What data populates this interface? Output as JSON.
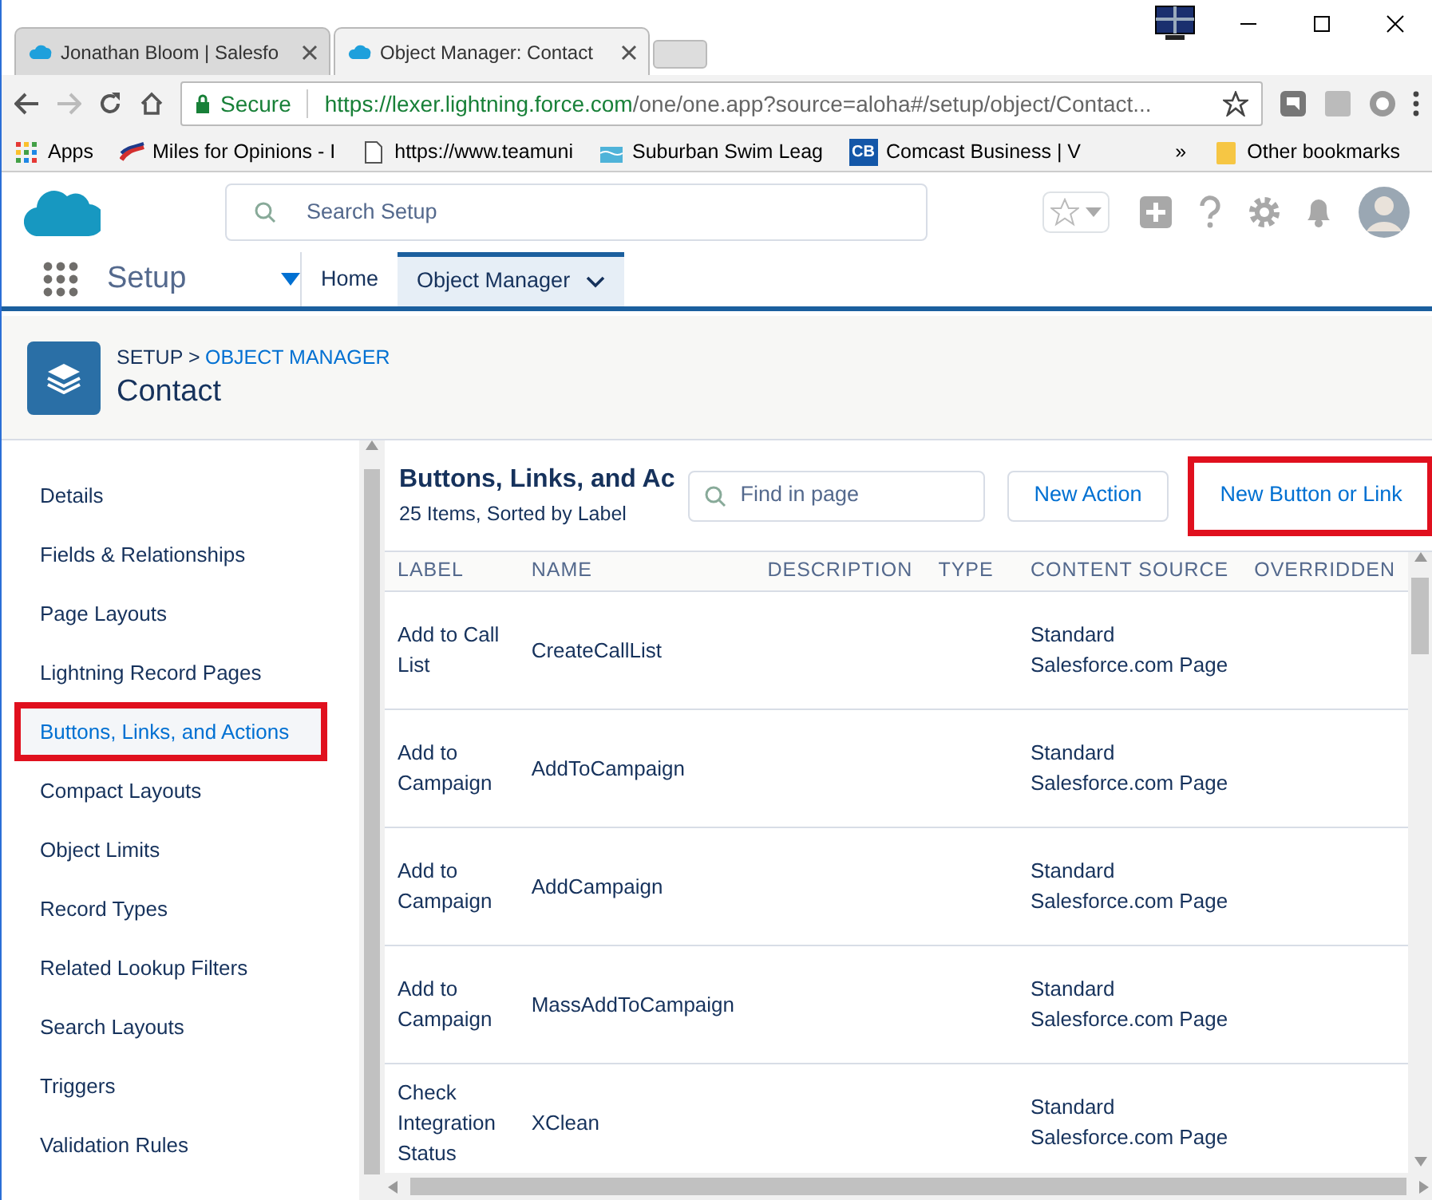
{
  "browser": {
    "tabs": [
      {
        "title": "Jonathan Bloom | Salesfo",
        "selected": false
      },
      {
        "title": "Object Manager: Contact",
        "selected": true
      }
    ],
    "security": "Secure",
    "url_host": "https://lexer.lightning.force.com",
    "url_path": "/one/one.app?source=aloha#/setup/object/Contact...",
    "bookmarks": [
      {
        "label": "Apps",
        "kind": "apps"
      },
      {
        "label": "Miles for Opinions - I",
        "kind": "flag"
      },
      {
        "label": "https://www.teamuni",
        "kind": "page"
      },
      {
        "label": "Suburban Swim Leag",
        "kind": "swim"
      },
      {
        "label": "Comcast Business | V",
        "kind": "cb",
        "badge": "CB"
      }
    ],
    "more": "»",
    "other_bookmarks": "Other bookmarks"
  },
  "header": {
    "search_placeholder": "Search Setup",
    "app_name": "Setup",
    "nav": [
      {
        "label": "Home",
        "selected": false,
        "dropdown": false
      },
      {
        "label": "Object Manager",
        "selected": true,
        "dropdown": true
      }
    ]
  },
  "page_header": {
    "breadcrumb_root": "SETUP",
    "breadcrumb_sep": ">",
    "breadcrumb_link": "OBJECT MANAGER",
    "title": "Contact"
  },
  "sidebar": {
    "items": [
      {
        "label": "Details",
        "selected": false,
        "highlighted": false
      },
      {
        "label": "Fields & Relationships",
        "selected": false,
        "highlighted": false
      },
      {
        "label": "Page Layouts",
        "selected": false,
        "highlighted": false
      },
      {
        "label": "Lightning Record Pages",
        "selected": false,
        "highlighted": false
      },
      {
        "label": "Buttons, Links, and Actions",
        "selected": true,
        "highlighted": true
      },
      {
        "label": "Compact Layouts",
        "selected": false,
        "highlighted": false
      },
      {
        "label": "Object Limits",
        "selected": false,
        "highlighted": false
      },
      {
        "label": "Record Types",
        "selected": false,
        "highlighted": false
      },
      {
        "label": "Related Lookup Filters",
        "selected": false,
        "highlighted": false
      },
      {
        "label": "Search Layouts",
        "selected": false,
        "highlighted": false
      },
      {
        "label": "Triggers",
        "selected": false,
        "highlighted": false
      },
      {
        "label": "Validation Rules",
        "selected": false,
        "highlighted": false
      }
    ]
  },
  "main": {
    "title": "Buttons, Links, and Ac",
    "subtitle": "25 Items, Sorted by Label",
    "find_placeholder": "Find in page",
    "buttons": [
      {
        "label": "New Action",
        "highlighted": false
      },
      {
        "label": "New Button or Link",
        "highlighted": true
      }
    ],
    "table": {
      "columns": [
        "LABEL",
        "NAME",
        "DESCRIPTION",
        "TYPE",
        "CONTENT SOURCE",
        "OVERRIDDEN"
      ],
      "rows": [
        [
          "Add to Call List",
          "CreateCallList",
          "",
          "",
          "Standard Salesforce.com Page",
          ""
        ],
        [
          "Add to Campaign",
          "AddToCampaign",
          "",
          "",
          "Standard Salesforce.com Page",
          ""
        ],
        [
          "Add to Campaign",
          "AddCampaign",
          "",
          "",
          "Standard Salesforce.com Page",
          ""
        ],
        [
          "Add to Campaign",
          "MassAddToCampaign",
          "",
          "",
          "Standard Salesforce.com Page",
          ""
        ],
        [
          "Check Integration Status",
          "XClean",
          "",
          "",
          "Standard Salesforce.com Page",
          ""
        ]
      ]
    }
  }
}
